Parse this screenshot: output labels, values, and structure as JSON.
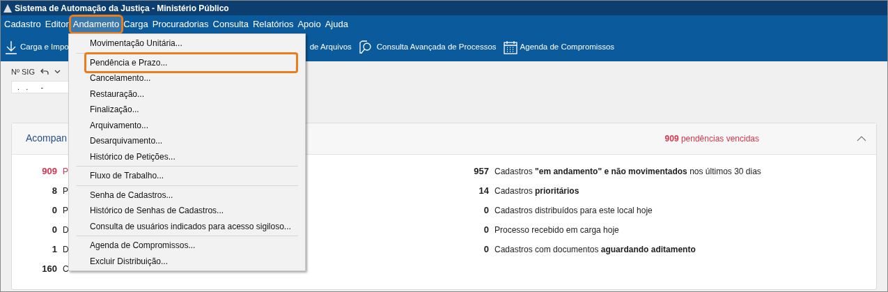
{
  "window": {
    "title": "Sistema de Automação da Justiça - Ministério Público"
  },
  "menubar": [
    {
      "label": "Cadastro",
      "selected": false
    },
    {
      "label": "Editor",
      "selected": false
    },
    {
      "label": "Andamento",
      "selected": true
    },
    {
      "label": "Carga",
      "selected": false
    },
    {
      "label": "Procuradorias",
      "selected": false
    },
    {
      "label": "Consulta",
      "selected": false
    },
    {
      "label": "Relatórios",
      "selected": false
    },
    {
      "label": "Apoio",
      "selected": false
    },
    {
      "label": "Ajuda",
      "selected": false
    }
  ],
  "toolbar": [
    {
      "label": "Carga e Impo",
      "kind": "download"
    },
    {
      "label": "de Arquivos",
      "kind": "text"
    },
    {
      "label": "Consulta Avançada de Processos",
      "kind": "search"
    },
    {
      "label": "Agenda de Compromissos",
      "kind": "calendar"
    }
  ],
  "sig_field": {
    "label": "Nº SIG",
    "value": ".   .      -"
  },
  "dropdown_menu": [
    {
      "kind": "item",
      "label": "Movimentação Unitária...",
      "highlighted": false
    },
    {
      "kind": "separator"
    },
    {
      "kind": "item",
      "label": "Pendência e Prazo...",
      "highlighted": true
    },
    {
      "kind": "item",
      "label": "Cancelamento...",
      "highlighted": false
    },
    {
      "kind": "item",
      "label": "Restauração...",
      "highlighted": false
    },
    {
      "kind": "item",
      "label": "Finalização...",
      "highlighted": false
    },
    {
      "kind": "item",
      "label": "Arquivamento...",
      "highlighted": false
    },
    {
      "kind": "item",
      "label": "Desarquivamento...",
      "highlighted": false
    },
    {
      "kind": "item",
      "label": "Histórico de Petições...",
      "highlighted": false
    },
    {
      "kind": "separator"
    },
    {
      "kind": "item",
      "label": "Fluxo de Trabalho...",
      "highlighted": false
    },
    {
      "kind": "separator"
    },
    {
      "kind": "item",
      "label": "Senha de Cadastros...",
      "highlighted": false
    },
    {
      "kind": "item",
      "label": "Histórico de Senhas de Cadastros...",
      "highlighted": false
    },
    {
      "kind": "item",
      "label": "Consulta de usuários indicados para acesso sigiloso...",
      "highlighted": false
    },
    {
      "kind": "separator"
    },
    {
      "kind": "item",
      "label": "Agenda de Compromissos...",
      "highlighted": false
    },
    {
      "kind": "item",
      "label": "Excluir Distribuição...",
      "highlighted": false
    }
  ],
  "panel": {
    "title": "Acompan",
    "overdue_count": "909",
    "overdue_label": "pendências vencidas",
    "expanded": true,
    "left_rows": [
      {
        "count": "909",
        "text": "P",
        "alert": true
      },
      {
        "count": "8",
        "text": "P",
        "alert": false
      },
      {
        "count": "0",
        "text": "P",
        "alert": false
      },
      {
        "count": "0",
        "text": "D",
        "alert": false
      },
      {
        "count": "1",
        "text": "D",
        "alert": false
      },
      {
        "count": "160",
        "text": "C",
        "alert": false
      }
    ],
    "right_rows": [
      {
        "count": "957",
        "text": "Cadastros **\"em andamento\" e não movimentados** nos últimos 30 dias",
        "alert": false
      },
      {
        "count": "14",
        "text": "Cadastros **prioritários**",
        "alert": false
      },
      {
        "count": "0",
        "text": "Cadastros distribuídos para este local hoje",
        "alert": false
      },
      {
        "count": "0",
        "text": "Processo recebido em carga hoje",
        "alert": false
      },
      {
        "count": "0",
        "text": "Cadastros com documentos **aguardando aditamento**",
        "alert": false
      }
    ]
  }
}
